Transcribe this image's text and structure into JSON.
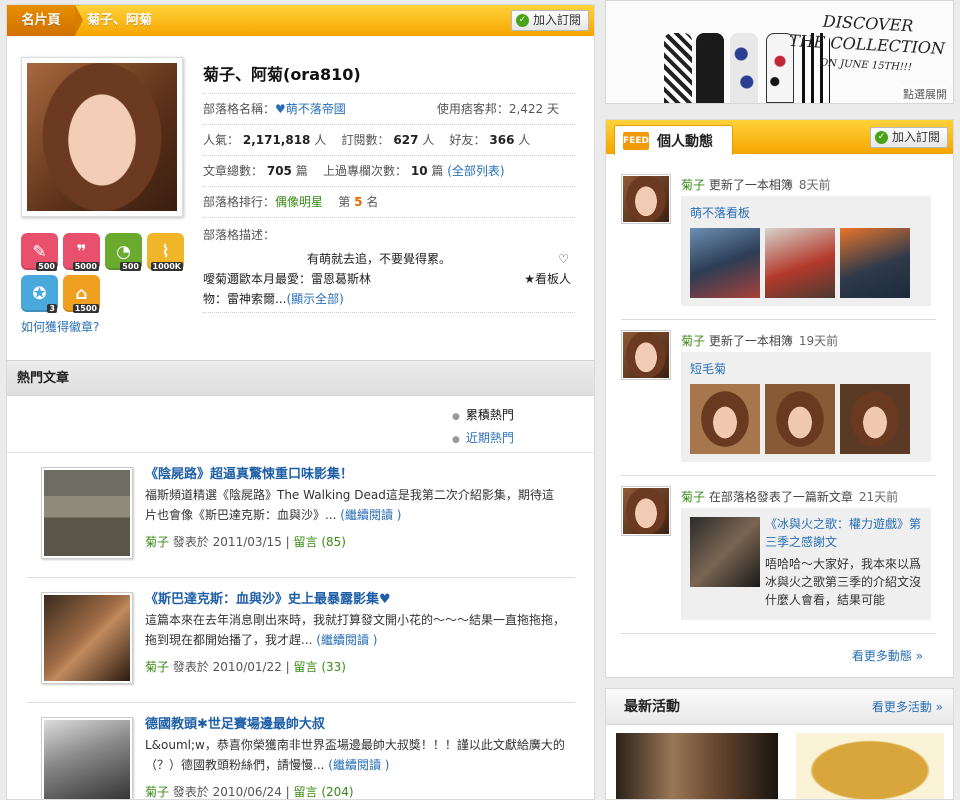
{
  "profile_tabs": {
    "tab_card": "名片頁",
    "tab_name": "菊子、阿菊",
    "subscribe": "加入訂閱"
  },
  "profile": {
    "name": "菊子、阿菊(ora810)",
    "blog_name_label": "部落格名稱：",
    "blog_name": "♥萌不落帝國",
    "days_label": "使用痞客邦：",
    "days": "2,422 天",
    "pop_label": "人氣：",
    "pop": "2,171,818",
    "people_unit": "人",
    "subs_label": "訂閱數：",
    "subs": "627",
    "friends_label": "好友：",
    "friends": "366",
    "articles_label": "文章總數：",
    "articles": "705",
    "articles_unit": "篇",
    "top_label": "上過專欄次數：",
    "top_count": "10",
    "top_unit": "篇",
    "top_link": "(全部列表)",
    "rank_label": "部落格排行：",
    "rank_cat": "偶像明星",
    "rank_pre": "第",
    "rank_num": "5",
    "rank_post": "名",
    "desc_label": "部落格描述：",
    "desc_line1": "有萌就去追，不要覺得累。",
    "desc_heart": "♡",
    "desc_line2": "噯菊邇歐本月最愛：雷恩葛斯林",
    "desc_line2b": "★看板人",
    "desc_line3": "物：雷神索爾...",
    "desc_more": "(顯示全部)"
  },
  "badges": [
    {
      "icon": "pencil-icon",
      "count": "500",
      "color": "#e8506e"
    },
    {
      "icon": "chat-icon",
      "count": "5000",
      "color": "#e8506e"
    },
    {
      "icon": "rss-icon",
      "count": "500",
      "color": "#6aab2f"
    },
    {
      "icon": "chart-icon",
      "count": "1000K",
      "color": "#f0b528"
    },
    {
      "icon": "medal-icon",
      "count": "3",
      "color": "#4aa9dc"
    },
    {
      "icon": "home-icon",
      "count": "1500",
      "color": "#f0a020"
    }
  ],
  "how_link": "如何獲得徽章?",
  "hot": {
    "title": "熱門文章",
    "tab_cumulative": "累積熱門",
    "tab_recent": "近期熱門"
  },
  "articles": [
    {
      "title": "《陰屍路》超逼真驚悚重口味影集！",
      "summary": "福斯頻道精選《陰屍路》The Walking Dead這是我第二次介紹影集，期待這片也會像《斯巴達克斯：血與沙》...",
      "read_more": "(繼續閱讀 )",
      "author": "菊子",
      "posted": "發表於 2011/03/15",
      "sep": "|",
      "comments": "留言 (85)"
    },
    {
      "title": "《斯巴達克斯：血與沙》史上最暴露影集♥",
      "summary": "這篇本來在去年消息剛出來時，我就打算發文開小花的～～～結果一直拖拖拖，拖到現在都開始播了，我才趕...",
      "read_more": "(繼續閱讀 )",
      "author": "菊子",
      "posted": "發表於 2010/01/22",
      "sep": "|",
      "comments": "留言 (33)"
    },
    {
      "title": "德國教頭✱世足賽場邊最帥大叔",
      "summary": "L&ouml;w，恭喜你榮獲南非世界盃場邊最帥大叔獎！！！謹以此文獻給廣大的（？）德國教頭粉絲們，請慢慢...",
      "read_more": "(繼續閱讀 )",
      "author": "菊子",
      "posted": "發表於 2010/06/24",
      "sep": "|",
      "comments": "留言 (204)"
    }
  ],
  "banner": {
    "line1": "DISCOVER",
    "line2": "THE COLLECTION",
    "line3": "ON JUNE 15TH!!!",
    "footer": "點選展開"
  },
  "feed": {
    "title": "個人動態",
    "rss_label": "FEED",
    "subscribe": "加入訂閱",
    "items": [
      {
        "user": "菊子",
        "action": "更新了一本相簿",
        "time": "8天前",
        "album": "萌不落看板"
      },
      {
        "user": "菊子",
        "action": "更新了一本相簿",
        "time": "19天前",
        "album": "短毛菊"
      },
      {
        "user": "菊子",
        "action": "在部落格發表了一篇新文章",
        "time": "21天前",
        "post_title": "《冰與火之歌：權力遊戲》第三季之感謝文",
        "post_summary": "唔哈哈～大家好，我本來以爲冰與火之歌第三季的介紹文沒什麼人會看，結果可能"
      }
    ],
    "more": "看更多動態 »"
  },
  "events": {
    "title": "最新活動",
    "more": "看更多活動 »"
  },
  "colors": {
    "brand_orange": "#f6a500",
    "link_blue": "#2a6fb6",
    "user_green": "#3a8a16"
  }
}
